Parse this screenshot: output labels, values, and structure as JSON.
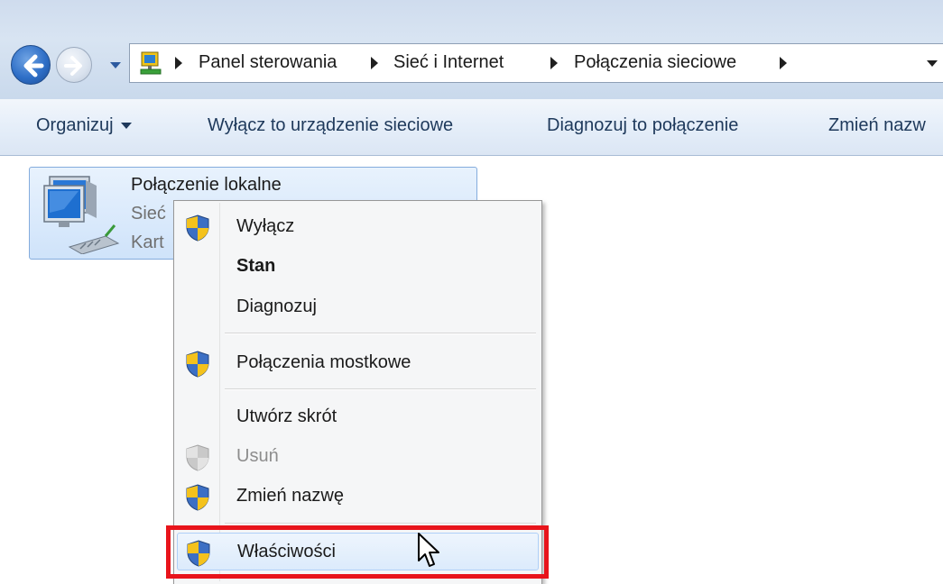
{
  "address_bar": {
    "breadcrumbs": [
      "Panel sterowania",
      "Sieć i Internet",
      "Połączenia sieciowe"
    ]
  },
  "toolbar": {
    "organize_label": "Organizuj",
    "disable_label": "Wyłącz to urządzenie sieciowe",
    "diagnose_label": "Diagnozuj to połączenie",
    "rename_label": "Zmień nazw"
  },
  "connection": {
    "name": "Połączenie lokalne",
    "line1": "Sieć",
    "line2": "Kart"
  },
  "context_menu": {
    "items": [
      {
        "label": "Wyłącz",
        "icon": "uac-shield-icon"
      },
      {
        "label": "Stan",
        "icon": null,
        "default": true
      },
      {
        "label": "Diagnozuj",
        "icon": null
      },
      {
        "label": "Połączenia mostkowe",
        "icon": "uac-shield-icon"
      },
      {
        "label": "Utwórz skrót",
        "icon": null
      },
      {
        "label": "Usuń",
        "icon": "uac-shield-icon",
        "disabled": true
      },
      {
        "label": "Zmień nazwę",
        "icon": "uac-shield-icon"
      },
      {
        "label": "Właściwości",
        "icon": "uac-shield-icon",
        "hovered": true
      }
    ]
  },
  "colors": {
    "highlight_border": "#e8141b",
    "hover_fill": "#dcebfc",
    "toolbar_text": "#1e395b"
  }
}
